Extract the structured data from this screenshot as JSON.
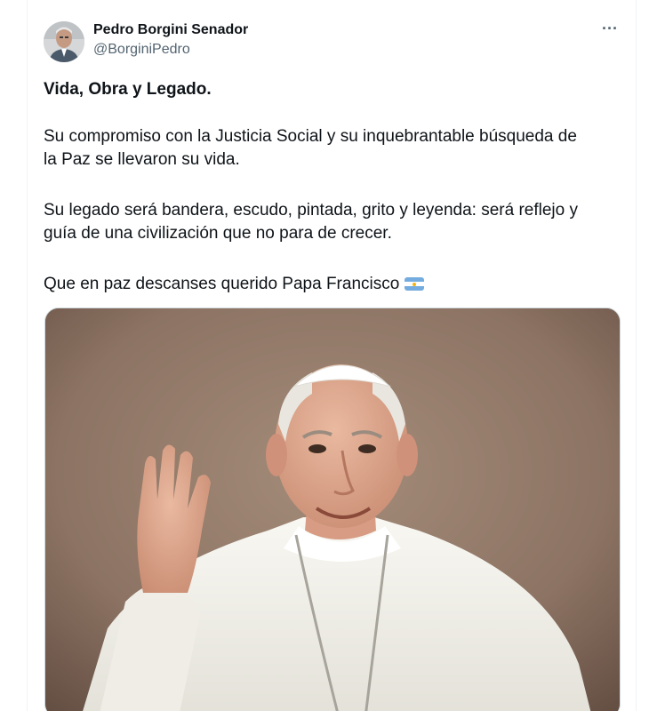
{
  "tweet": {
    "author_name": "Pedro Borgini Senador",
    "handle": "@BorginiPedro",
    "more_icon": "more-horizontal-icon",
    "text_title": "Vida, Obra y Legado.",
    "para1_line1": "Su compromiso con la Justicia Social y su inquebrantable búsqueda de",
    "para1_line2": "la Paz se llevaron su vida.",
    "para2_line1": "Su legado será  bandera, escudo, pintada, grito y leyenda: será reflejo y",
    "para2_line2": "guía de una civilización que no para de crecer.",
    "para3": "Que en paz descanses querido Papa Francisco",
    "flag_icon": "argentina-flag-icon"
  },
  "colors": {
    "text": "#0f1419",
    "secondary": "#536471",
    "border": "#cfd9de",
    "flag_blue": "#74acdf",
    "flag_sun": "#f6b40e"
  }
}
